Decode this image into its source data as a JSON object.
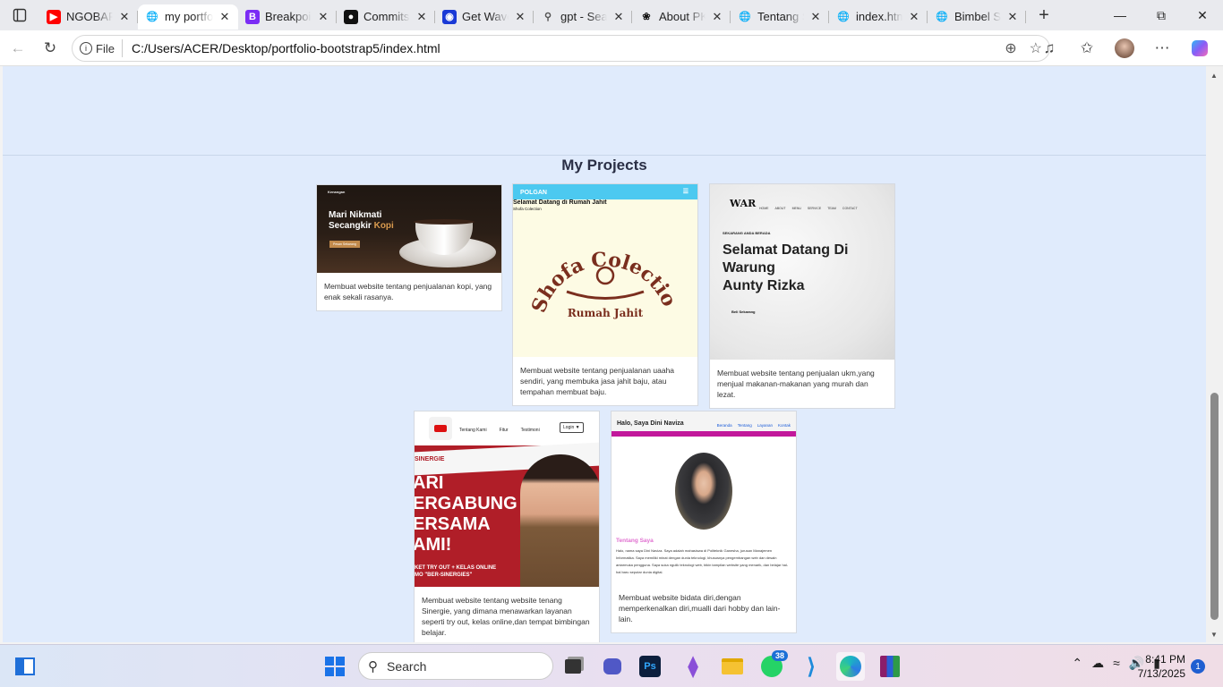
{
  "tabs": [
    {
      "title": "NGOBAR",
      "icon": "youtube-icon"
    },
    {
      "title": "my portfo",
      "icon": "globe-icon",
      "active": true
    },
    {
      "title": "Breakpoi",
      "icon": "bootstrap-icon"
    },
    {
      "title": "Commits",
      "icon": "github-icon"
    },
    {
      "title": "Get Wave",
      "icon": "wave-icon"
    },
    {
      "title": "gpt - Sea",
      "icon": "search-icon"
    },
    {
      "title": "About PK",
      "icon": "openai-icon"
    },
    {
      "title": "Tentang S",
      "icon": "globe-icon"
    },
    {
      "title": "index.htm",
      "icon": "globe-icon"
    },
    {
      "title": "Bimbel Si",
      "icon": "globe-icon"
    }
  ],
  "address": {
    "label": "File",
    "url": "C:/Users/ACER/Desktop/portfolio-bootstrap5/index.html"
  },
  "page": {
    "section_title": "My Projects",
    "projects": [
      {
        "desc": "Membuat website tentang penjualanan kopi, yang enak sekali rasanya.",
        "shot": {
          "brand": "Kenangan",
          "heading1": "Mari Nikmati",
          "heading2": "Secangkir",
          "accent": "Kopi",
          "btn": "Pesan Sekarang"
        }
      },
      {
        "desc": "Membuat website tentang penjualanan uaaha sendiri, yang membuka jasa jahit baju, atau tempahan membuat baju.",
        "shot": {
          "brand": "POLGAN",
          "heading": "Selamat Datang di Rumah Jahit",
          "sub": "Shofa Colection",
          "logo_arc": "Shofa Colection",
          "logo_text": "Rumah Jahit"
        }
      },
      {
        "desc": "Membuat website tentang penjualan ukm,yang menjual makanan-makanan yang murah dan lezat.",
        "shot": {
          "logo": "WAR",
          "nav": [
            "HOME",
            "ABOUT",
            "MENU",
            "SERVICE",
            "TEAM",
            "CONTACT"
          ],
          "eyebrow": "SEKARANG ANDA BERADA",
          "heading": [
            "Selamat Datang Di",
            "Warung",
            "Aunty Rizka"
          ],
          "btn": "Beli Sekarang"
        }
      },
      {
        "desc": "Membuat website tentang website tenang Sinergie, yang dimana menawarkan layanan seperti try out, kelas online,dan tempat bimbingan belajar.",
        "shot": {
          "nav": [
            "Tentang Kami",
            "Fitur",
            "Testimoni"
          ],
          "login": "Login ▼",
          "brand": "SINERGIE",
          "lines": [
            "ARI",
            "ERGABUNG",
            "ERSAMA",
            "AMI!"
          ],
          "footer1": "KET TRY OUT + KELAS ONLINE",
          "footer2": "MO \"BER-SINERGIES\""
        }
      },
      {
        "desc": "Membuat website bidata diri,dengan memperkenalkan diri,mualli dari hobby dan lain-lain.",
        "shot": {
          "title": "Halo, Saya Dini Naviza",
          "nav": [
            "Beranda",
            "Tentang",
            "Layanan",
            "Kontak"
          ],
          "about": "Tentang Saya",
          "about_text": "Halo, nama saya Dini Naviza. Saya adalah mahasiswa di Politeknik Ganesha, jurusan Manajemen Informatika. Saya memiliki minat dengan dunia teknologi, khususnya pengembangan web dan desain antarmuka pengguna. Saya suka ngulik teknologi web, bikin tampilan website yang menarik, dan belajar hal-hal baru seputar dunia digital."
        }
      }
    ]
  },
  "taskbar": {
    "search": "Search",
    "whatsapp_badge": "38",
    "time": "8:41 PM",
    "date": "7/13/2025",
    "notifications": "1"
  },
  "colors": {
    "page_bg": "#e0ebfc",
    "polgan_bar": "#4cc9f0",
    "sinergie_red": "#b01e28",
    "profile_accent": "#c2189b"
  }
}
